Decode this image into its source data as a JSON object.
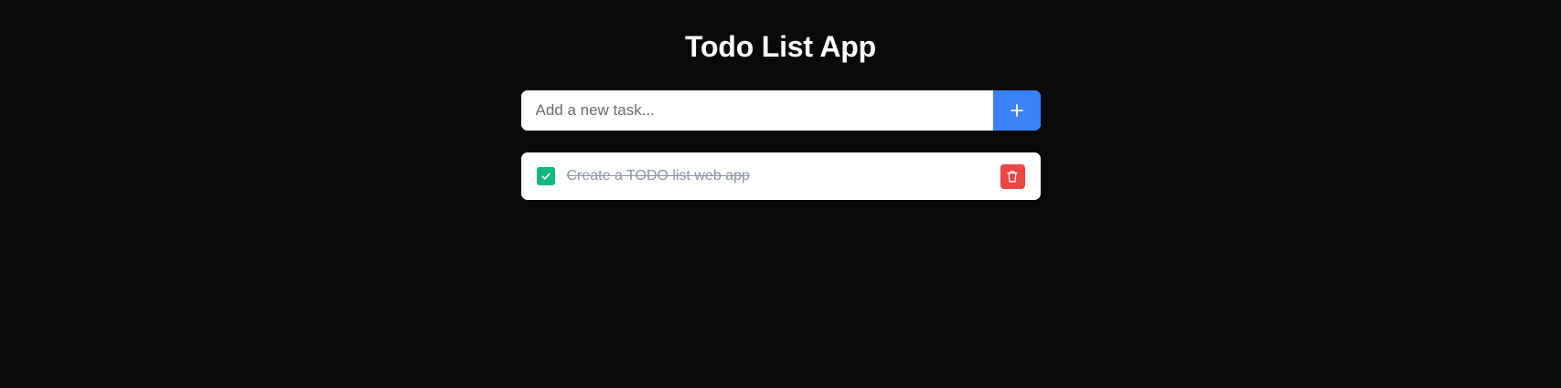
{
  "app": {
    "title": "Todo List App"
  },
  "new_task": {
    "placeholder": "Add a new task...",
    "value": "",
    "add_icon": "plus-icon"
  },
  "tasks": [
    {
      "text": "Create a TODO list web app",
      "completed": true,
      "check_icon": "check-icon",
      "delete_icon": "trash-icon"
    }
  ],
  "colors": {
    "background": "#0a0a0a",
    "accent": "#3b82f6",
    "completed": "#10b981",
    "delete": "#ef4444",
    "completed_text": "#8b94a3"
  }
}
